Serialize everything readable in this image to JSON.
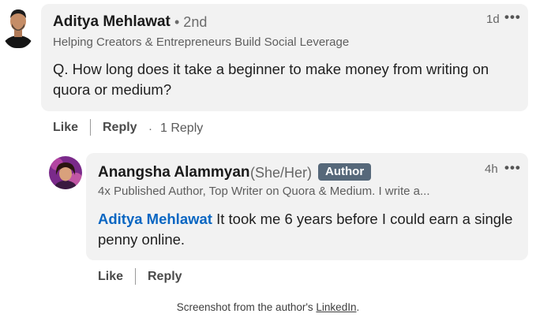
{
  "comment": {
    "author_name": "Aditya Mehlawat",
    "connection_degree": "• 2nd",
    "headline": "Helping Creators & Entrepreneurs Build Social Leverage",
    "timestamp": "1d",
    "body": "Q. How long does it take a beginner to make money from writing on quora or medium?",
    "actions": {
      "like": "Like",
      "reply": "Reply",
      "reply_count": "1 Reply"
    }
  },
  "reply": {
    "author_name": "Anangsha Alammyan",
    "pronouns": "(She/Her)",
    "badge": "Author",
    "headline": "4x Published Author, Top Writer on Quora & Medium. I write a...",
    "timestamp": "4h",
    "mention": "Aditya Mehlawat",
    "body": " It took me 6 years before I could earn a single penny online.",
    "actions": {
      "like": "Like",
      "reply": "Reply"
    }
  },
  "caption": {
    "prefix": "Screenshot from the author's ",
    "link": "LinkedIn",
    "suffix": "."
  },
  "icons": {
    "more": "more-options-icon",
    "avatar1": "avatar-photo",
    "avatar2": "avatar-photo"
  },
  "colors": {
    "bubble": "#f2f2f2",
    "mention": "#0a66c2",
    "badge": "#56687a"
  }
}
